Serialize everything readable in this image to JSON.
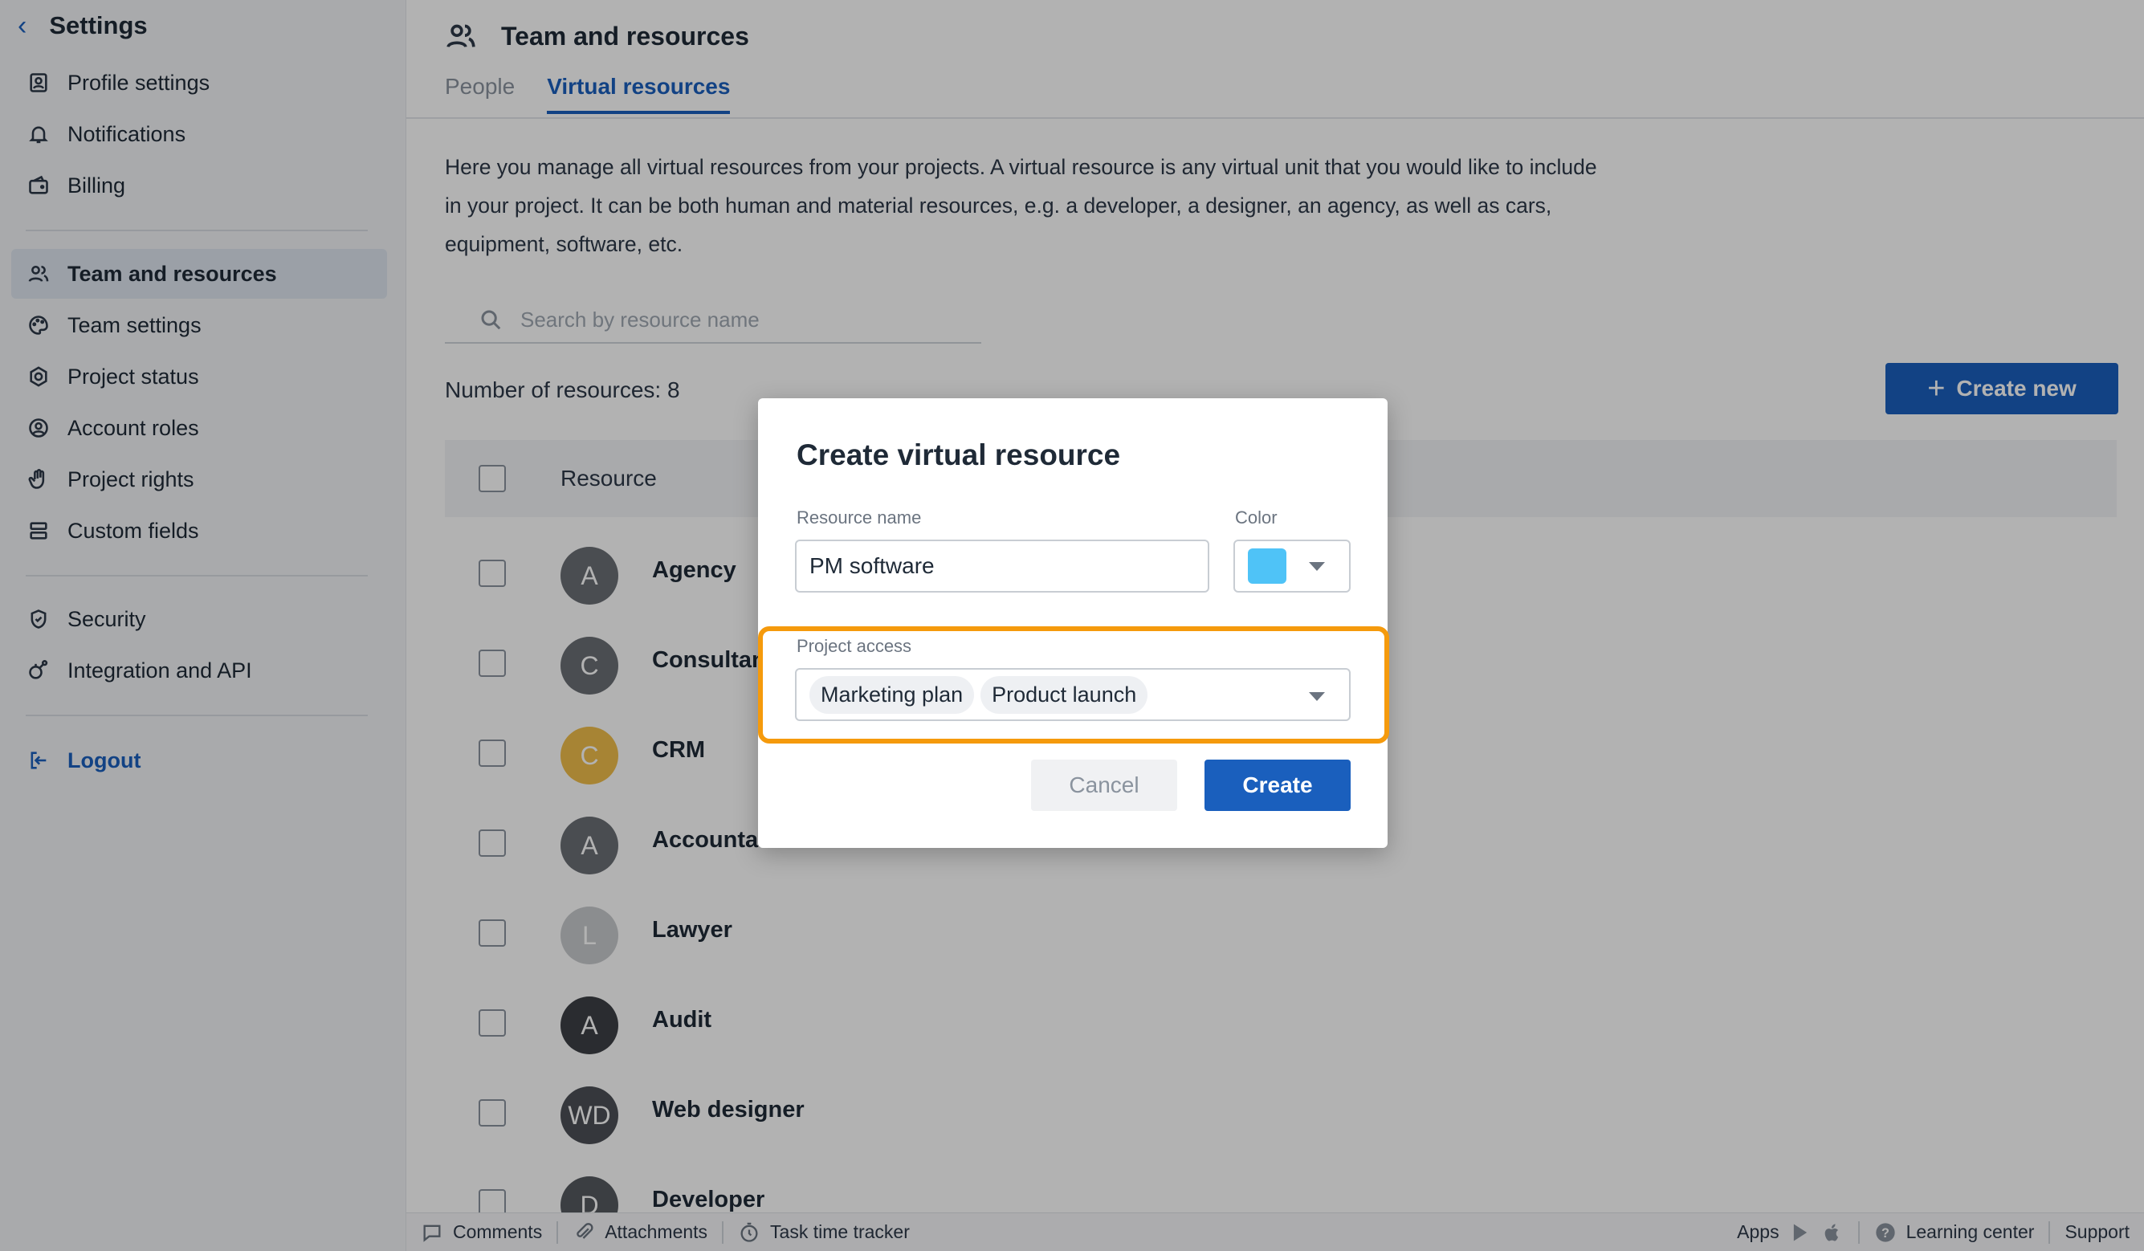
{
  "sidebar": {
    "title": "Settings",
    "items": [
      {
        "label": "Profile settings",
        "icon": "profile-icon"
      },
      {
        "label": "Notifications",
        "icon": "bell-icon"
      },
      {
        "label": "Billing",
        "icon": "wallet-icon"
      },
      {
        "label": "Team and resources",
        "icon": "users-icon",
        "active": true
      },
      {
        "label": "Team settings",
        "icon": "palette-icon"
      },
      {
        "label": "Project status",
        "icon": "status-icon"
      },
      {
        "label": "Account roles",
        "icon": "user-circle-icon"
      },
      {
        "label": "Project rights",
        "icon": "hand-icon"
      },
      {
        "label": "Custom fields",
        "icon": "fields-icon"
      },
      {
        "label": "Security",
        "icon": "shield-icon"
      },
      {
        "label": "Integration and API",
        "icon": "integration-icon"
      }
    ],
    "logout": "Logout"
  },
  "main": {
    "title": "Team and resources",
    "tabs": [
      {
        "label": "People",
        "active": false
      },
      {
        "label": "Virtual resources",
        "active": true
      }
    ],
    "description": "Here you manage all virtual resources from your projects. A virtual resource is any virtual unit that you would like to include in your project. It can be both human and material resources, e.g. a developer, a designer, an agency, as well as cars, equipment, software, etc.",
    "search_placeholder": "Search by resource name",
    "count_label": "Number of resources: 8",
    "create_new_label": "Create new",
    "table": {
      "column": "Resource",
      "rows": [
        {
          "initials": "A",
          "name": "Agency",
          "color": "#6b6f75"
        },
        {
          "initials": "C",
          "name": "Consultant",
          "color": "#6b6f75"
        },
        {
          "initials": "C",
          "name": "CRM",
          "color": "#f0be4b"
        },
        {
          "initials": "A",
          "name": "Accountant",
          "color": "#6b6f75"
        },
        {
          "initials": "L",
          "name": "Lawyer",
          "color": "#c8cacd"
        },
        {
          "initials": "A",
          "name": "Audit",
          "color": "#3d4045"
        },
        {
          "initials": "WD",
          "name": "Web designer",
          "color": "#4c5056"
        },
        {
          "initials": "D",
          "name": "Developer",
          "color": "#55595f"
        }
      ]
    }
  },
  "footer": {
    "comments": "Comments",
    "attachments": "Attachments",
    "tracker": "Task time tracker",
    "apps": "Apps",
    "learning": "Learning center",
    "support": "Support"
  },
  "dialog": {
    "title": "Create virtual resource",
    "name_label": "Resource name",
    "name_value": "PM software",
    "color_label": "Color",
    "color_value": "#4fc3f7",
    "project_label": "Project access",
    "projects": [
      "Marketing plan",
      "Product launch"
    ],
    "cancel": "Cancel",
    "create": "Create"
  }
}
